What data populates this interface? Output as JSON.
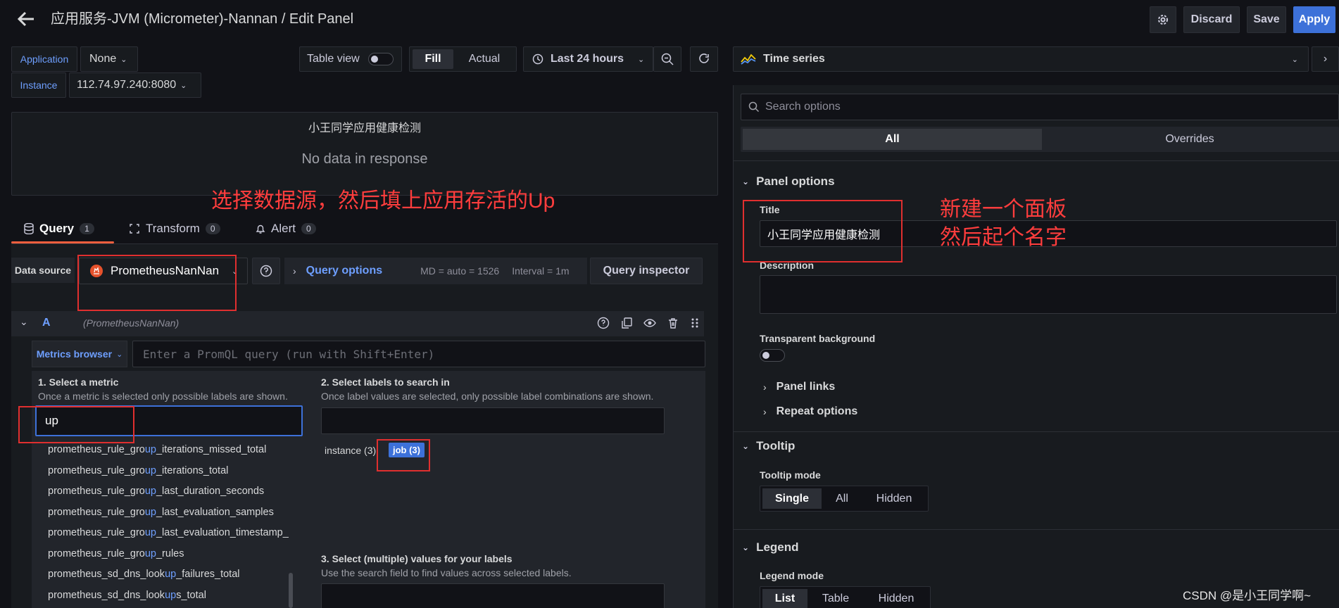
{
  "header": {
    "title": "应用服务-JVM (Micrometer)-Nannan / Edit Panel",
    "discard": "Discard",
    "save": "Save",
    "apply": "Apply"
  },
  "variables": {
    "application_label": "Application",
    "application_value": "None",
    "instance_label": "Instance",
    "instance_value": "112.74.97.240:8080"
  },
  "toolbar": {
    "table_view": "Table view",
    "fill": "Fill",
    "actual": "Actual",
    "time_range": "Last 24 hours"
  },
  "preview": {
    "panel_title": "小王同学应用健康检测",
    "no_data": "No data in response"
  },
  "annotations": {
    "left": "选择数据源，然后填上应用存活的Up",
    "right_line1": "新建一个面板",
    "right_line2": "然后起个名字"
  },
  "tabs": [
    {
      "label": "Query",
      "count": "1"
    },
    {
      "label": "Transform",
      "count": "0"
    },
    {
      "label": "Alert",
      "count": "0"
    }
  ],
  "query_bar": {
    "data_source_label": "Data source",
    "data_source_value": "PrometheusNanNan",
    "query_options": "Query options",
    "md": "MD = auto = 1526",
    "interval": "Interval = 1m",
    "inspector": "Query inspector"
  },
  "query_row": {
    "letter": "A",
    "source": "(PrometheusNanNan)",
    "metrics_browser": "Metrics browser",
    "placeholder": "Enter a PromQL query (run with Shift+Enter)"
  },
  "browser": {
    "s1_title": "1. Select a metric",
    "s1_desc": "Once a metric is selected only possible labels are shown.",
    "metric_search": "up",
    "metrics": [
      {
        "pre": "prometheus_rule_gro",
        "hl": "up",
        "post": "_iterations_missed_total"
      },
      {
        "pre": "prometheus_rule_gro",
        "hl": "up",
        "post": "_iterations_total"
      },
      {
        "pre": "prometheus_rule_gro",
        "hl": "up",
        "post": "_last_duration_seconds"
      },
      {
        "pre": "prometheus_rule_gro",
        "hl": "up",
        "post": "_last_evaluation_samples"
      },
      {
        "pre": "prometheus_rule_gro",
        "hl": "up",
        "post": "_last_evaluation_timestamp_s"
      },
      {
        "pre": "prometheus_rule_gro",
        "hl": "up",
        "post": "_rules"
      },
      {
        "pre": "prometheus_sd_dns_look",
        "hl": "up",
        "post": "_failures_total"
      },
      {
        "pre": "prometheus_sd_dns_look",
        "hl": "up",
        "post": "s_total"
      }
    ],
    "s2_title": "2. Select labels to search in",
    "s2_desc": "Once label values are selected, only possible label combinations are shown.",
    "label_instance": "instance (3)",
    "label_job": "job (3)",
    "s3_title": "3. Select (multiple) values for your labels",
    "s3_desc": "Use the search field to find values across selected labels."
  },
  "options": {
    "viz": "Time series",
    "search_placeholder": "Search options",
    "tab_all": "All",
    "tab_overrides": "Overrides",
    "panel_options": "Panel options",
    "title_label": "Title",
    "title_value": "小王同学应用健康检测",
    "description_label": "Description",
    "transparent_label": "Transparent background",
    "panel_links": "Panel links",
    "repeat_options": "Repeat options",
    "tooltip": "Tooltip",
    "tooltip_mode_label": "Tooltip mode",
    "tooltip_modes": [
      "Single",
      "All",
      "Hidden"
    ],
    "legend": "Legend",
    "legend_mode_label": "Legend mode",
    "legend_modes": [
      "List",
      "Table",
      "Hidden"
    ]
  },
  "watermark": "CSDN @是小王同学啊~",
  "colors": {
    "accent": "#3d71d9",
    "annotation": "#ff3d3d",
    "background": "#111217"
  }
}
